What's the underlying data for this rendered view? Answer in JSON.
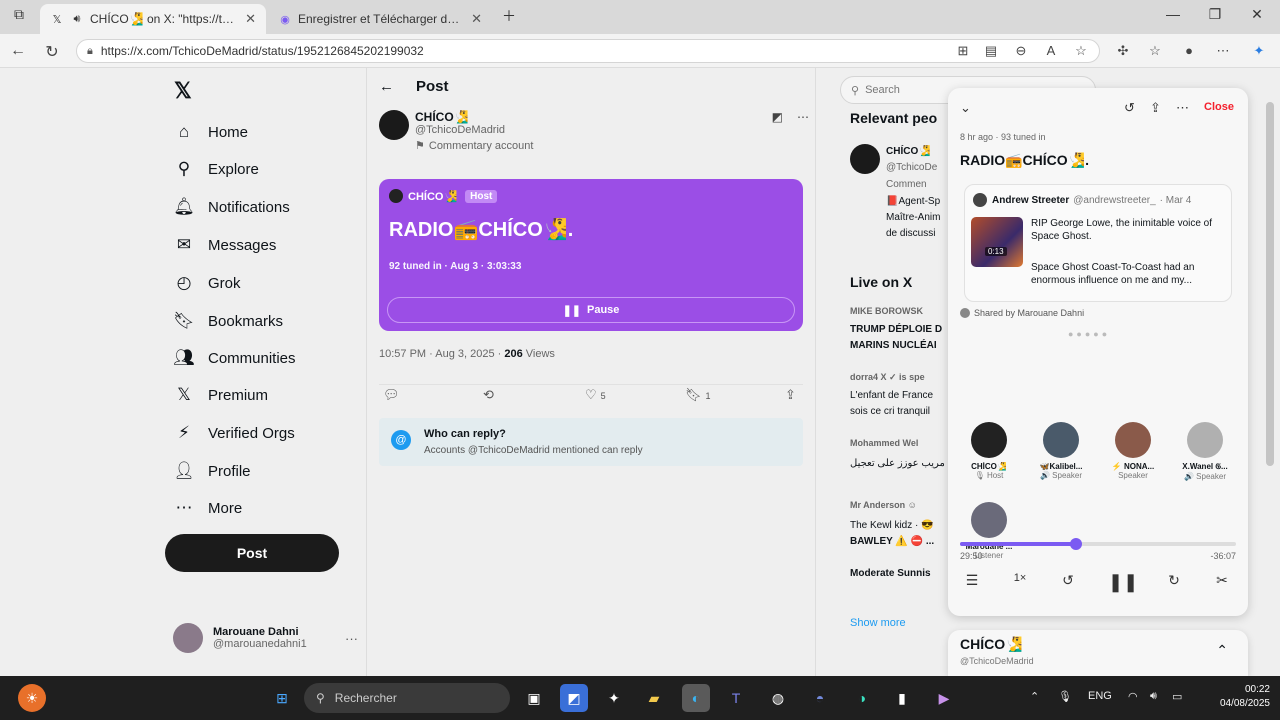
{
  "browser": {
    "tabs": [
      {
        "title": "CHÍCO🧏‍♂️ on X: \"https://t.co",
        "active": true
      },
      {
        "title": "Enregistrer et Télécharger des Sp",
        "active": false
      }
    ],
    "url": "https://x.com/TchicoDeMadrid/status/1952126845202199032"
  },
  "nav": {
    "logo": "𝕏",
    "items": [
      {
        "label": "Home",
        "icon": "⌂",
        "name": "home"
      },
      {
        "label": "Explore",
        "icon": "⚲",
        "name": "explore"
      },
      {
        "label": "Notifications",
        "icon": "🔔︎",
        "name": "notifications"
      },
      {
        "label": "Messages",
        "icon": "✉",
        "name": "messages"
      },
      {
        "label": "Grok",
        "icon": "◴",
        "name": "grok"
      },
      {
        "label": "Bookmarks",
        "icon": "🔖︎",
        "name": "bookmarks"
      },
      {
        "label": "Communities",
        "icon": "👥︎",
        "name": "communities"
      },
      {
        "label": "Premium",
        "icon": "𝕏",
        "name": "premium"
      },
      {
        "label": "Verified Orgs",
        "icon": "⚡︎",
        "name": "verified-orgs"
      },
      {
        "label": "Profile",
        "icon": "👤︎",
        "name": "profile"
      },
      {
        "label": "More",
        "icon": "⋯",
        "name": "more"
      }
    ],
    "post_label": "Post",
    "account": {
      "name": "Marouane Dahni",
      "handle": "@marouanedahni1",
      "more": "···"
    }
  },
  "post": {
    "header": "Post",
    "author_name": "CHÍCO🧏‍♂️",
    "author_handle": "@TchicoDeMadrid",
    "author_label": "Commentary account",
    "space": {
      "host": "CHÍCO🧏‍♂️",
      "badge": "Host",
      "title": "RADIO📻CHÍCO🧏‍♂️.",
      "meta": "92 tuned in · Aug 3 · 3:03:33",
      "pause_label": "Pause"
    },
    "time": "10:57 PM · Aug 3, 2025 · ",
    "views_count": "206",
    "views_label": " Views",
    "likes": "5",
    "bookmarks": "1",
    "reply_title": "Who can reply?",
    "reply_sub": "Accounts @TchicoDeMadrid mentioned can reply"
  },
  "right": {
    "search_placeholder": "Search",
    "relevant_header": "Relevant peo",
    "relevant_name": "CHÍCO🧏‍♂️",
    "relevant_handle": "@TchicoDe",
    "relevant_label": "Commen",
    "relevant_bio": [
      "📕Agent-Sp",
      "Maître-Anim",
      "de discussi"
    ],
    "live_header": "Live on X",
    "live_items": [
      {
        "who": "MIKE BOROWSK",
        "text": "TRUMP DÉPLOIE D",
        "text2": "MARINS NUCLÉAI"
      },
      {
        "who": "dorra4 X ✓ is spe",
        "text": "L'enfant de France",
        "text2": "sois ce cri tranquil"
      },
      {
        "who": "Mohammed Wel",
        "text": "مريب عوزز على تعجيل",
        "text2": ""
      },
      {
        "who": "Mr Anderson ☺",
        "text": "The Kewl kidz · 😎",
        "text2": "BAWLEY ⚠️ ⛔ ..."
      },
      {
        "who": "",
        "text": "Moderate Sunnis",
        "text2": ""
      }
    ],
    "show_more": "Show more"
  },
  "space_panel": {
    "close_label": "Close",
    "meta": "8 hr ago · 93 tuned in",
    "title": "RADIO📻CHÍCO🧏‍♂️.",
    "quote": {
      "name": "Andrew Streeter",
      "handle": "@andrewstreeter_",
      "date": "· Mar 4",
      "duration": "0:13",
      "line1": "RIP George Lowe, the inimitable voice of Space Ghost.",
      "line2": "Space Ghost Coast-To-Coast had an enormous influence on me and my..."
    },
    "shared_by": "Shared by Marouane Dahni",
    "speakers": [
      {
        "name": "CHÍCO🧏‍♂️",
        "role": "🎙 Host",
        "color": "#222"
      },
      {
        "name": "🦋Kalibel...",
        "role": "🔊 Speaker",
        "color": "#4a5a6a"
      },
      {
        "name": "⚡ NONA...",
        "role": "Speaker",
        "color": "#8a5a4a"
      },
      {
        "name": "X.Wanel 𝔊...",
        "role": "🔊 Speaker",
        "color": "#b0b0b0"
      },
      {
        "name": "Marouane ...",
        "role": "Listener",
        "color": "#6a6a7a"
      }
    ],
    "elapsed": "29:50",
    "remaining": "-36:07",
    "progress_fraction": 0.42,
    "speed": "1×",
    "mini_title": "CHÍCO🧏‍♂️",
    "mini_handle": "@TchicoDeMadrid"
  },
  "taskbar": {
    "search_placeholder": "Rechercher",
    "lang": "ENG",
    "time": "00:22",
    "date": "04/08/2025"
  }
}
